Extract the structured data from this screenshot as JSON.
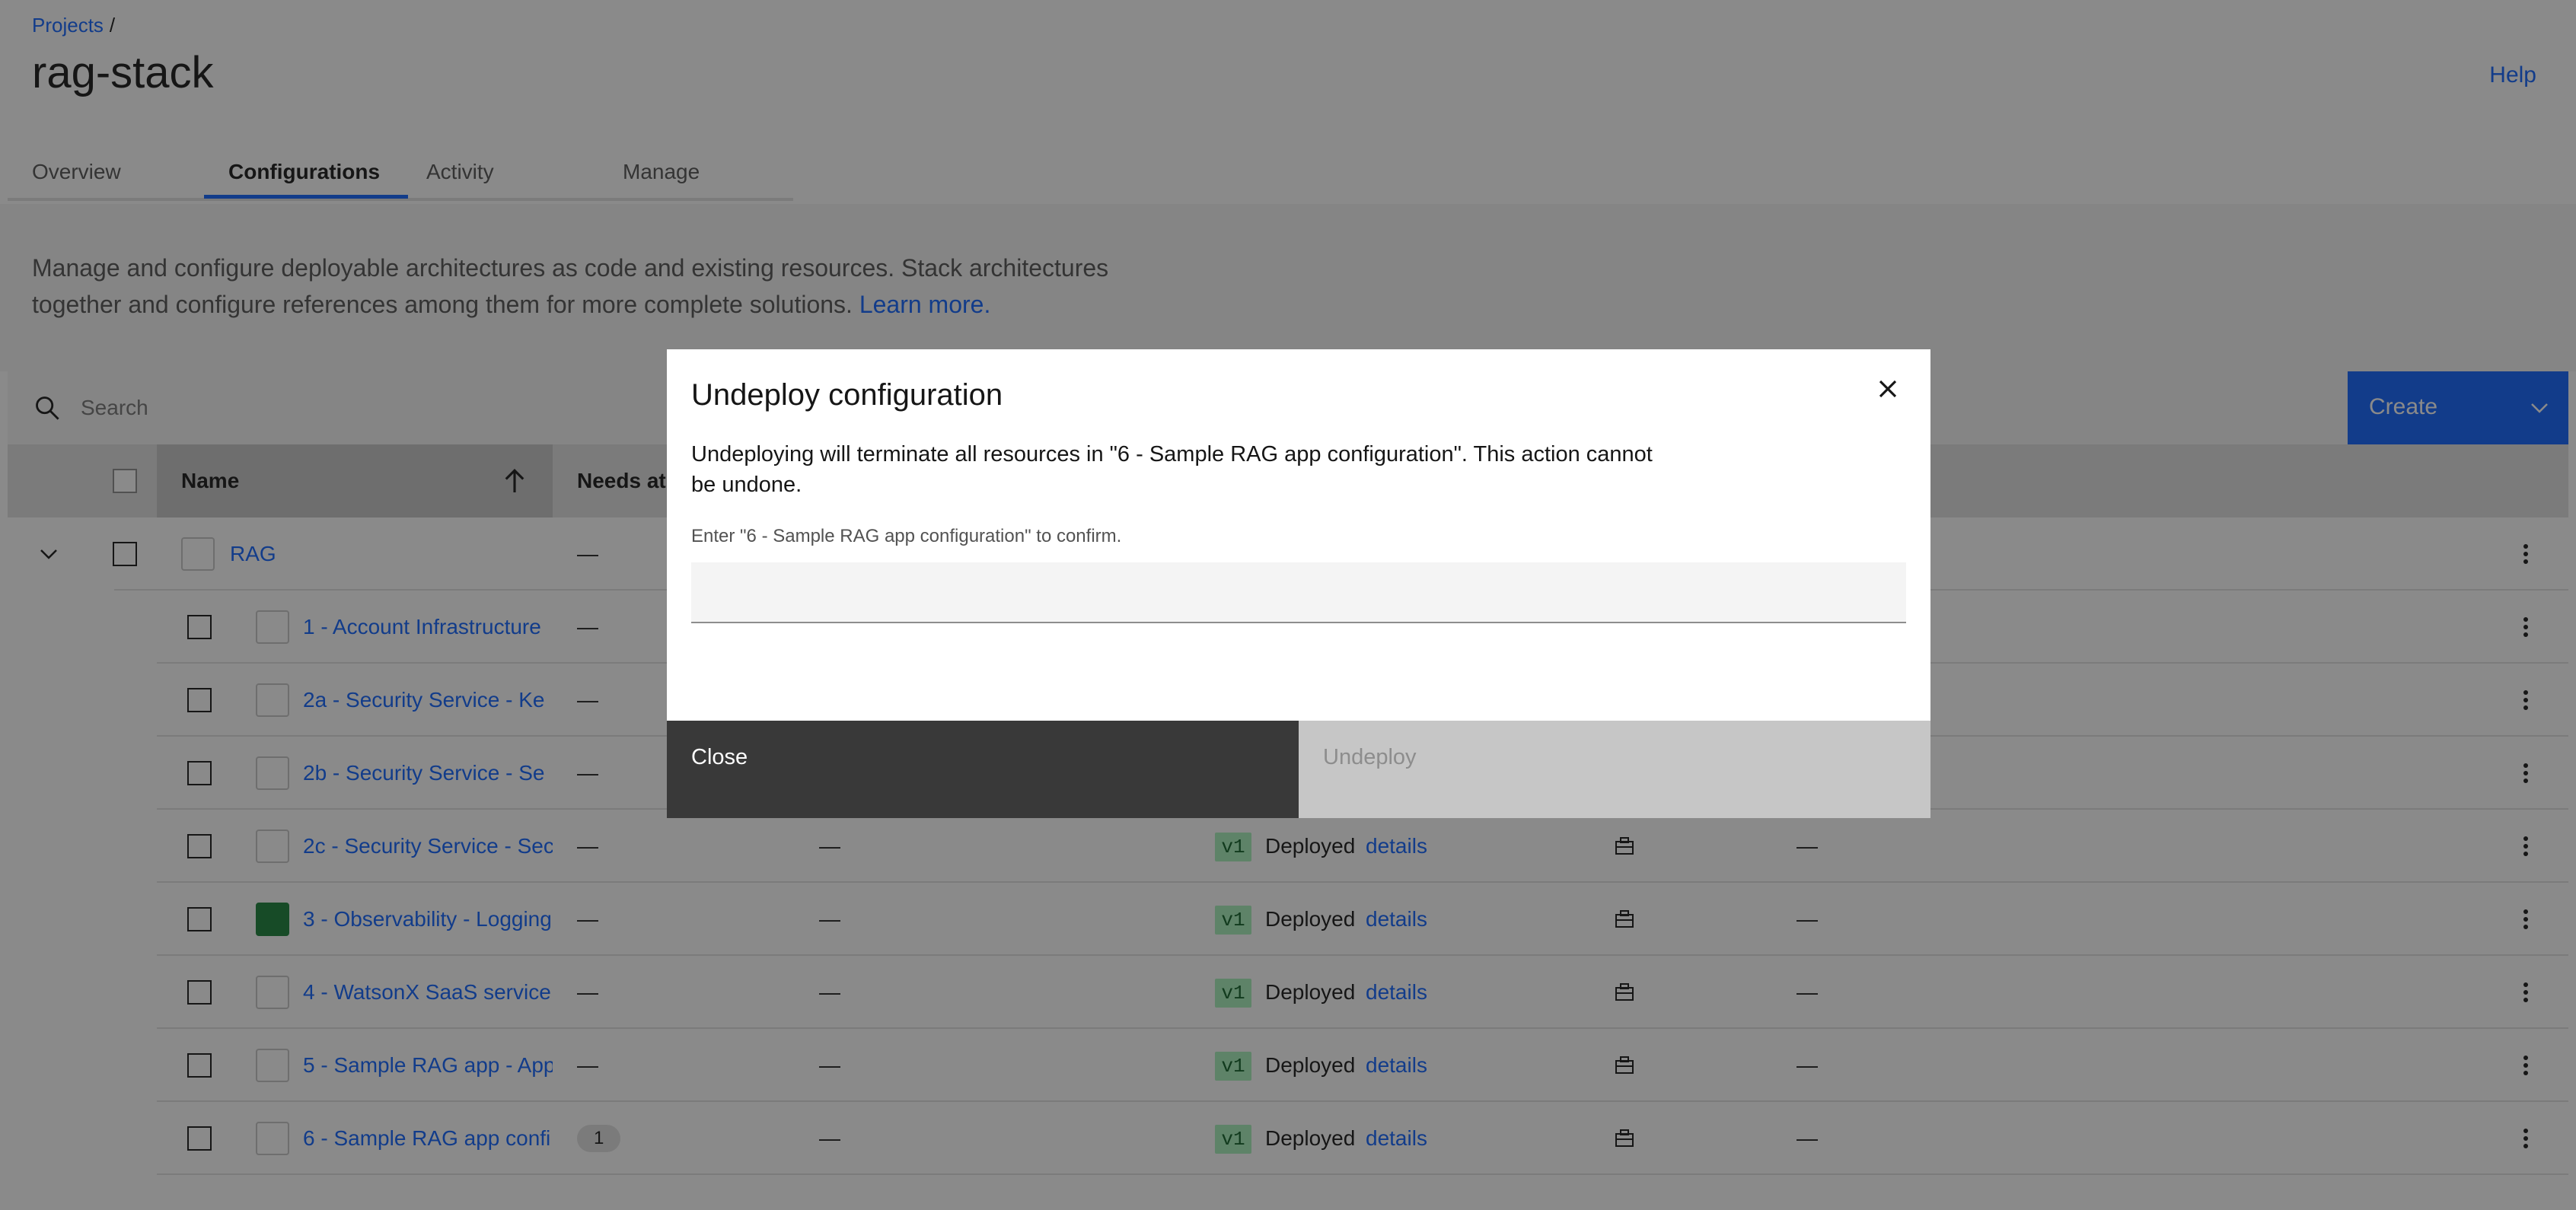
{
  "breadcrumb": {
    "projects": "Projects",
    "separator": "/"
  },
  "page": {
    "title": "rag-stack",
    "help": "Help"
  },
  "tabs": [
    {
      "label": "Overview"
    },
    {
      "label": "Configurations",
      "active": true
    },
    {
      "label": "Activity"
    },
    {
      "label": "Manage"
    }
  ],
  "description": {
    "text": "Manage and configure deployable architectures as code and existing resources. Stack architectures together and configure references among them for more complete solutions.",
    "learn_more": "Learn more."
  },
  "toolbar": {
    "search_placeholder": "Search",
    "create_label": "Create"
  },
  "table": {
    "headers": {
      "name": "Name",
      "needs_attention": "Needs at"
    },
    "parent": {
      "name": "RAG",
      "needs": "—"
    },
    "rows": [
      {
        "name": "1 - Account Infrastructure",
        "icon": "cloud-lock-icon",
        "needs": "—",
        "col3": "",
        "version": "",
        "status": "",
        "details": "",
        "col6": ""
      },
      {
        "name": "2a - Security Service - Ke",
        "icon": "key-shield-icon",
        "needs": "—",
        "col3": "",
        "version": "",
        "status": "",
        "details": "",
        "col6": ""
      },
      {
        "name": "2b - Security Service - Se",
        "icon": "secrets-icon",
        "needs": "—",
        "col3": "",
        "version": "",
        "status": "",
        "details": "",
        "col6": ""
      },
      {
        "name": "2c - Security Service - Sec",
        "icon": "cloud-lock-icon",
        "needs": "—",
        "col3": "—",
        "version": "v1",
        "status": "Deployed",
        "details": "details",
        "col6": "—"
      },
      {
        "name": "3 - Observability - Logging",
        "icon": "observability-icon",
        "needs": "—",
        "col3": "—",
        "version": "v1",
        "status": "Deployed",
        "details": "details",
        "col6": "—"
      },
      {
        "name": "4 - WatsonX SaaS service",
        "icon": "watsonx-icon",
        "needs": "—",
        "col3": "—",
        "version": "v1",
        "status": "Deployed",
        "details": "details",
        "col6": "—"
      },
      {
        "name": "5 - Sample RAG app - App",
        "icon": "app-flow-icon",
        "needs": "—",
        "col3": "—",
        "version": "v1",
        "status": "Deployed",
        "details": "details",
        "col6": "—"
      },
      {
        "name": "6 - Sample RAG app confi",
        "icon": "rag-config-icon",
        "needs": "1",
        "col3": "—",
        "version": "v1",
        "status": "Deployed",
        "details": "details",
        "col6": "—"
      }
    ]
  },
  "modal": {
    "title": "Undeploy configuration",
    "body": "Undeploying will terminate all resources in \"6 - Sample RAG app configuration\". This action cannot be undone.",
    "confirm_label": "Enter \"6 - Sample RAG app configuration\" to confirm.",
    "confirm_value": "",
    "close_label": "Close",
    "undeploy_label": "Undeploy"
  },
  "colors": {
    "accent": "#0f62fe",
    "deployed_tag_bg": "#a7f0ba",
    "overlay": "rgba(22,22,22,0.5)",
    "close_button": "#393939",
    "disabled_button": "#c6c6c6"
  }
}
